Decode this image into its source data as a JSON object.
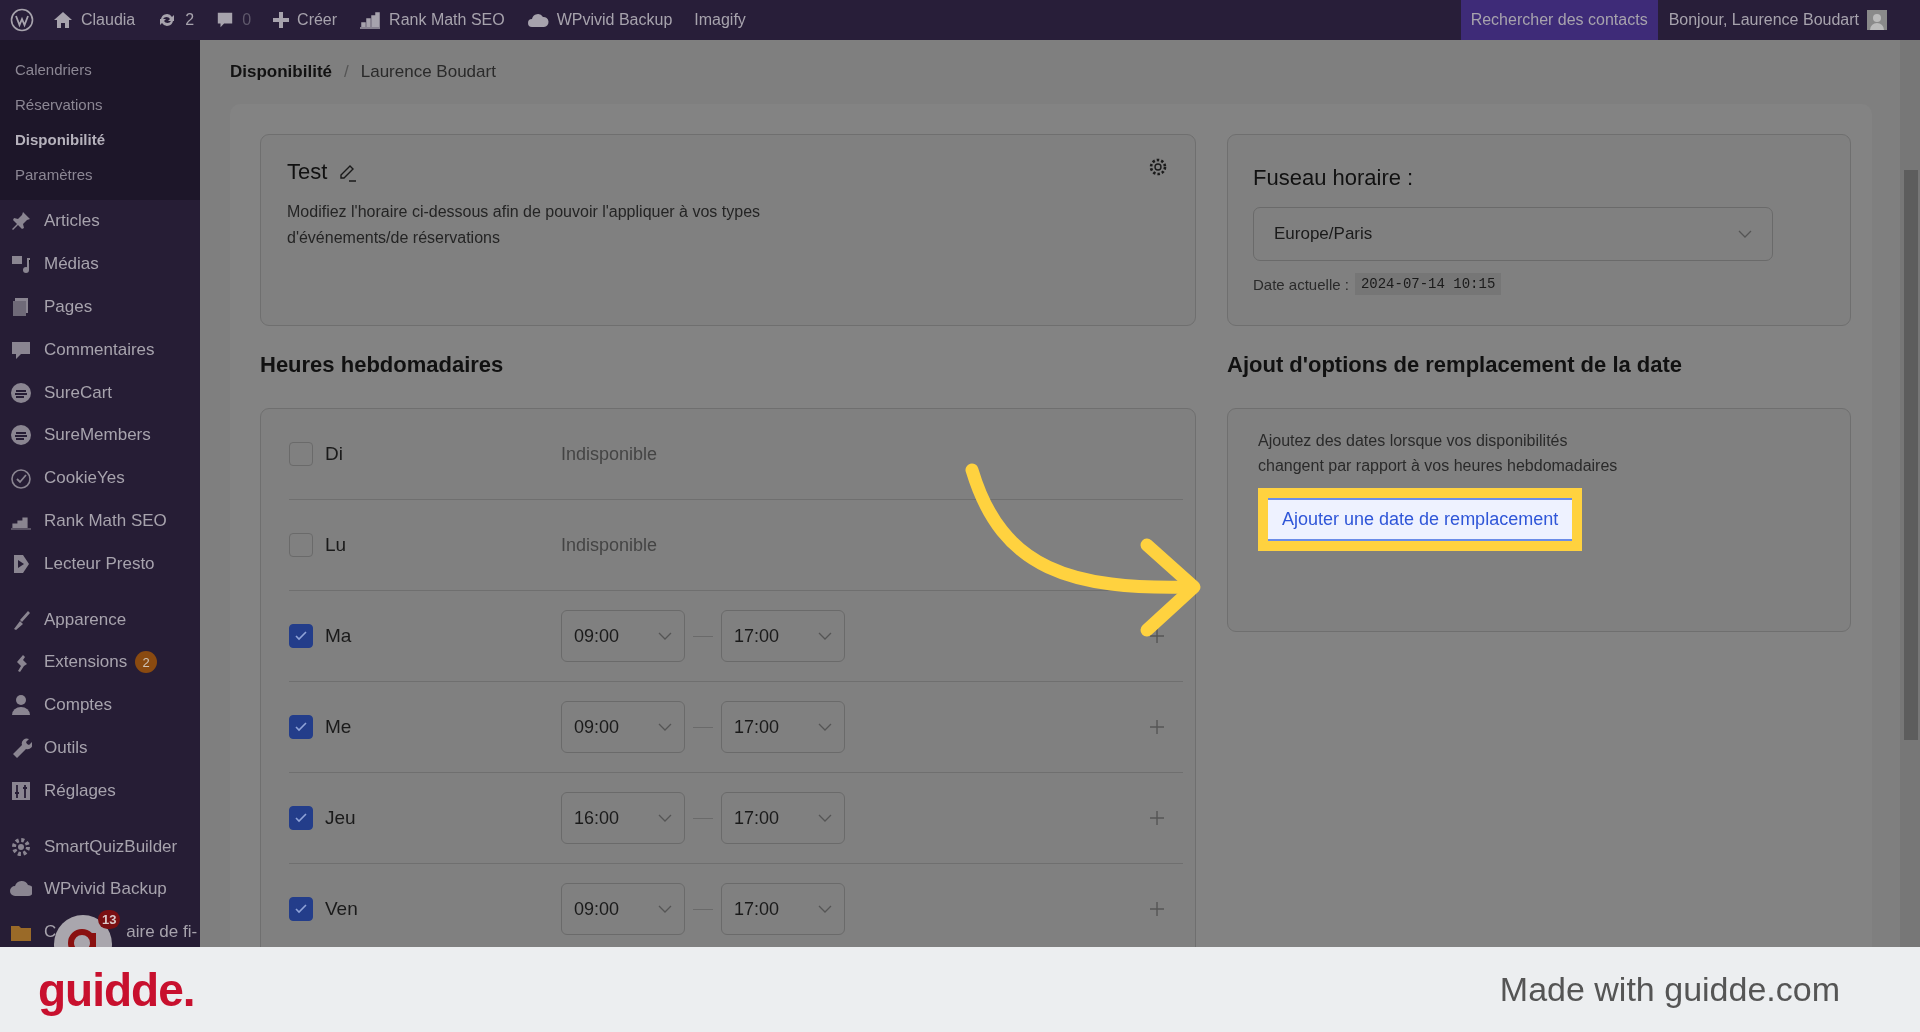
{
  "top_bar": {
    "items": [
      {
        "label": "Claudia"
      },
      {
        "label": "2"
      },
      {
        "label": "0",
        "muted": true
      },
      {
        "label": "Créer"
      },
      {
        "label": "Rank Math SEO"
      },
      {
        "label": "WPvivid Backup"
      },
      {
        "label": "Imagify"
      }
    ],
    "search_contacts": "Rechercher des contacts",
    "greeting": "Bonjour, Laurence Boudart"
  },
  "sidebar": {
    "submenu": [
      {
        "label": "Calendriers",
        "selected": false
      },
      {
        "label": "Réservations",
        "selected": false
      },
      {
        "label": "Disponibilité",
        "selected": true
      },
      {
        "label": "Paramètres",
        "selected": false
      }
    ],
    "groups": [
      {
        "items": [
          {
            "label": "Articles"
          },
          {
            "label": "Médias"
          },
          {
            "label": "Pages"
          },
          {
            "label": "Commentaires"
          },
          {
            "label": "SureCart"
          },
          {
            "label": "SureMembers"
          },
          {
            "label": "CookieYes"
          },
          {
            "label": "Rank Math SEO"
          },
          {
            "label": "Lecteur Presto"
          }
        ]
      },
      {
        "items": [
          {
            "label": "Apparence"
          },
          {
            "label": "Extensions",
            "badge": "2"
          },
          {
            "label": "Comptes"
          },
          {
            "label": "Outils"
          },
          {
            "label": "Réglages"
          }
        ]
      },
      {
        "items": [
          {
            "label": "SmartQuizBuilder"
          },
          {
            "label": "WPvivid Backup"
          },
          {
            "label": "C",
            "label_after": "aire de fi-"
          }
        ]
      }
    ],
    "chat_bubble_count": "13"
  },
  "breadcrumb": {
    "current": "Disponibilité",
    "separator": "/",
    "name": "Laurence Boudart"
  },
  "schedule_card": {
    "title": "Test",
    "description": "Modifiez l'horaire ci-dessous afin de pouvoir l'appliquer à vos types d'événements/de réservations"
  },
  "timezone_card": {
    "title": "Fuseau horaire :",
    "value": "Europe/Paris",
    "date_label": "Date actuelle :",
    "date_value": "2024-07-14 10:15"
  },
  "weekly_hours": {
    "title": "Heures hebdomadaires",
    "days": [
      {
        "label": "Di",
        "checked": false,
        "status": "Indisponible"
      },
      {
        "label": "Lu",
        "checked": false,
        "status": "Indisponible"
      },
      {
        "label": "Ma",
        "checked": true,
        "start": "09:00",
        "end": "17:00"
      },
      {
        "label": "Me",
        "checked": true,
        "start": "09:00",
        "end": "17:00"
      },
      {
        "label": "Jeu",
        "checked": true,
        "start": "16:00",
        "end": "17:00"
      },
      {
        "label": "Ven",
        "checked": true,
        "start": "09:00",
        "end": "17:00"
      }
    ]
  },
  "date_overrides": {
    "title": "Ajout d'options de remplacement de la date",
    "description": "Ajoutez des dates lorsque vos disponibilités changent par rapport à vos heures hebdomadaires",
    "button": "Ajouter une date de remplacement"
  },
  "footer": {
    "brand": "guidde.",
    "credit": "Made with guidde.com"
  }
}
